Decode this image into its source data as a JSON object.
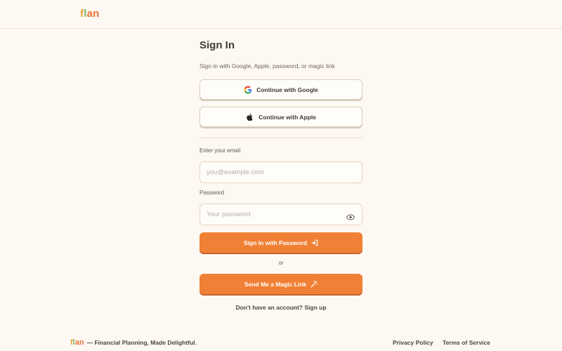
{
  "header": {
    "logo": {
      "f": "f",
      "l": "l",
      "a": "a",
      "n": "n"
    }
  },
  "signin": {
    "title": "Sign In",
    "subtitle": "Sign in with Google, Apple, password, or magic link",
    "google_label": "Continue with Google",
    "apple_label": "Continue with Apple",
    "email_label": "Enter your email",
    "email_placeholder": "you@example.com",
    "email_value": "",
    "password_label": "Password",
    "password_placeholder": "Your password",
    "password_value": "",
    "password_submit": "Sign In with Password",
    "or_text": "or",
    "magic_link": "Send Me a Magic Link",
    "signup_text": "Don't have an account? Sign up"
  },
  "footer": {
    "brand_logo": "flan",
    "tagline": "— Financial Planning, Made Delightful.",
    "privacy": "Privacy Policy",
    "terms": "Terms of Service"
  },
  "colors": {
    "background": "#fdf8f1",
    "accent": "#f08035",
    "logo_f": "#e9a23b",
    "logo_l": "#7bb36b",
    "logo_an": "#e8733a"
  },
  "icons": {
    "google": "google-icon",
    "apple": "apple-icon",
    "eye": "eye-icon",
    "login": "login-arrow-icon",
    "magic": "magic-wand-icon"
  }
}
